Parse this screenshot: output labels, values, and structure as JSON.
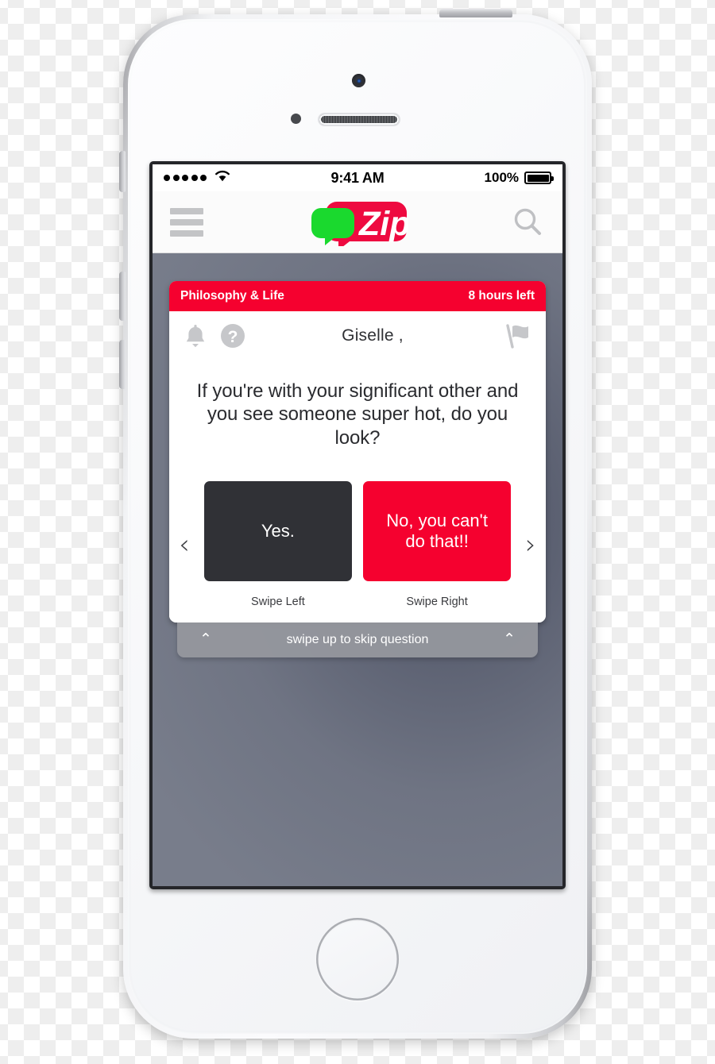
{
  "status_bar": {
    "signal_dots": 5,
    "wifi_icon": "wifi-icon",
    "time": "9:41 AM",
    "battery_percent": "100%",
    "battery_icon": "battery-full-icon"
  },
  "nav_bar": {
    "menu_icon": "hamburger-menu-icon",
    "logo_text": "Zip",
    "logo_trademark": "™",
    "search_icon": "search-icon"
  },
  "card": {
    "category": "Philosophy & Life",
    "time_left": "8 hours left",
    "bell_icon": "bell-icon",
    "help_icon": "question-mark-icon",
    "username": "Giselle ,",
    "flag_icon": "flag-icon",
    "question": "If you're with your significant other and you see someone super hot, do you look?",
    "prev_chevron": "‹",
    "next_chevron": "›",
    "answers": [
      {
        "text": "Yes.",
        "swipe_label": "Swipe Left",
        "style": "dark"
      },
      {
        "text": "No, you can't do that!!",
        "swipe_label": "Swipe Right",
        "style": "red"
      }
    ]
  },
  "skip_bar": {
    "label": "swipe up to skip question",
    "chevron_left": "⌃",
    "chevron_right": "⌃"
  },
  "colors": {
    "brand_red": "#f5012f",
    "brand_green": "#18d830",
    "dark_button": "#303136",
    "screen_bg_top": "#5b6071",
    "screen_bg_bottom": "#787d8b"
  }
}
